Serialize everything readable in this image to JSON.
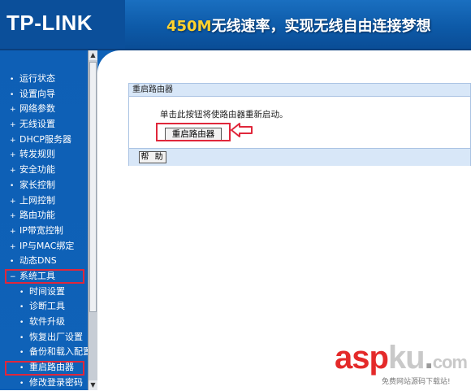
{
  "header": {
    "logo": "TP-LINK",
    "banner_highlight": "450M",
    "banner_rest": "无线速率，实现无线自由连接梦想"
  },
  "sidebar": {
    "items": [
      {
        "label": "运行状态",
        "bullet": "•"
      },
      {
        "label": "设置向导",
        "bullet": "•"
      },
      {
        "label": "网络参数",
        "bullet": "+"
      },
      {
        "label": "无线设置",
        "bullet": "+"
      },
      {
        "label": "DHCP服务器",
        "bullet": "+"
      },
      {
        "label": "转发规则",
        "bullet": "+"
      },
      {
        "label": "安全功能",
        "bullet": "+"
      },
      {
        "label": "家长控制",
        "bullet": "•"
      },
      {
        "label": "上网控制",
        "bullet": "+"
      },
      {
        "label": "路由功能",
        "bullet": "+"
      },
      {
        "label": "IP带宽控制",
        "bullet": "+"
      },
      {
        "label": "IP与MAC绑定",
        "bullet": "+"
      },
      {
        "label": "动态DNS",
        "bullet": "•"
      },
      {
        "label": "系统工具",
        "bullet": "−"
      },
      {
        "label": "时间设置",
        "bullet": "•"
      },
      {
        "label": "诊断工具",
        "bullet": "•"
      },
      {
        "label": "软件升级",
        "bullet": "•"
      },
      {
        "label": "恢复出厂设置",
        "bullet": "•"
      },
      {
        "label": "备份和载入配置",
        "bullet": "•"
      },
      {
        "label": "重启路由器",
        "bullet": "•"
      },
      {
        "label": "修改登录密码",
        "bullet": "•"
      }
    ]
  },
  "panel": {
    "title": "重启路由器",
    "description": "单击此按钮将使路由器重新启动。",
    "reboot_button": "重启路由器",
    "help_button": "帮 助"
  },
  "watermark": {
    "logo_red": "asp",
    "logo_gray": "ku",
    "logo_dot": ".",
    "logo_end": "com",
    "subtitle": "免费网站源码下载站!"
  },
  "colors": {
    "header_blue": "#0d5aa8",
    "sidebar_blue": "#0f62b8",
    "panel_header": "#d8e7f8",
    "highlight_red": "#e0273b"
  }
}
